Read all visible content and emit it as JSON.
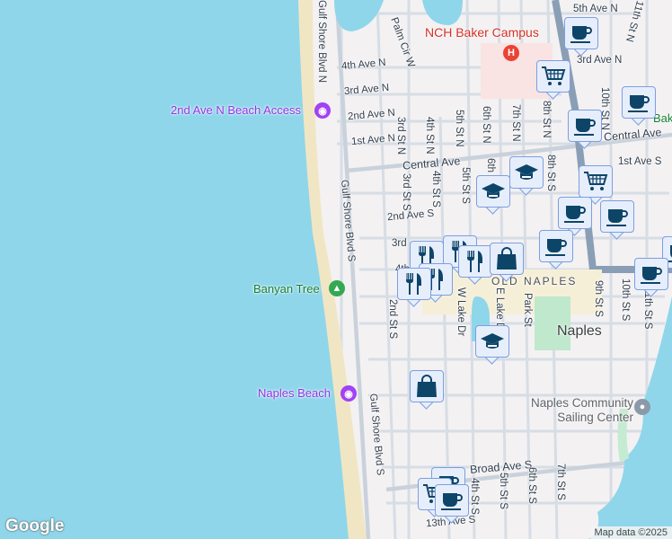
{
  "map": {
    "streets": [
      "5th Ave N",
      "4th Ave N",
      "3rd Ave N",
      "3rd Ave N",
      "2nd Ave N",
      "1st Ave N",
      "Central Ave",
      "Central Ave",
      "1st Ave S",
      "2nd Ave S",
      "3rd",
      "4th",
      "Broad Ave S",
      "13th Ave S",
      "Gulf Shore Blvd N",
      "Gulf Shore Blvd S",
      "Gulf Shore Blvd S",
      "Palm Cir W",
      "3rd St N",
      "4th St N",
      "5th St N",
      "6th St N",
      "7th St N",
      "8th St N",
      "10th St N",
      "11th St N",
      "3rd St S",
      "4th St S",
      "5th St S",
      "8th St S",
      "2nd St S",
      "W Lake Dr",
      "E Lake Dr",
      "Park St",
      "9th St S",
      "10th St S",
      "11th St S",
      "4th St S",
      "5th St S",
      "6th St S",
      "7th St S",
      "6th"
    ],
    "pois": {
      "hospital": "NCH Baker Campus",
      "beach_access": "2nd Ave N Beach Access",
      "banyan": "Banyan Tree",
      "naples_beach": "Naples Beach",
      "district": "OLD NAPLES",
      "city": "Naples",
      "sailing": "Naples Community Sailing Center",
      "baker": "Bake"
    },
    "markers": [
      "cup",
      "cart",
      "cup",
      "cup",
      "cap",
      "cap",
      "cart",
      "cup",
      "cup",
      "cup",
      "cup",
      "cup",
      "utensils",
      "utensils",
      "utensils",
      "utensils",
      "bag",
      "cap",
      "bag",
      "cart",
      "cup"
    ],
    "colors": {
      "water": "#8fd6ea",
      "land": "#f3f1f2",
      "road": "#d5dbe3",
      "arterial": "#8a9fb6",
      "marker_icon": "#0d4569"
    },
    "logo": "Google",
    "attribution": "Map data ©2025"
  }
}
